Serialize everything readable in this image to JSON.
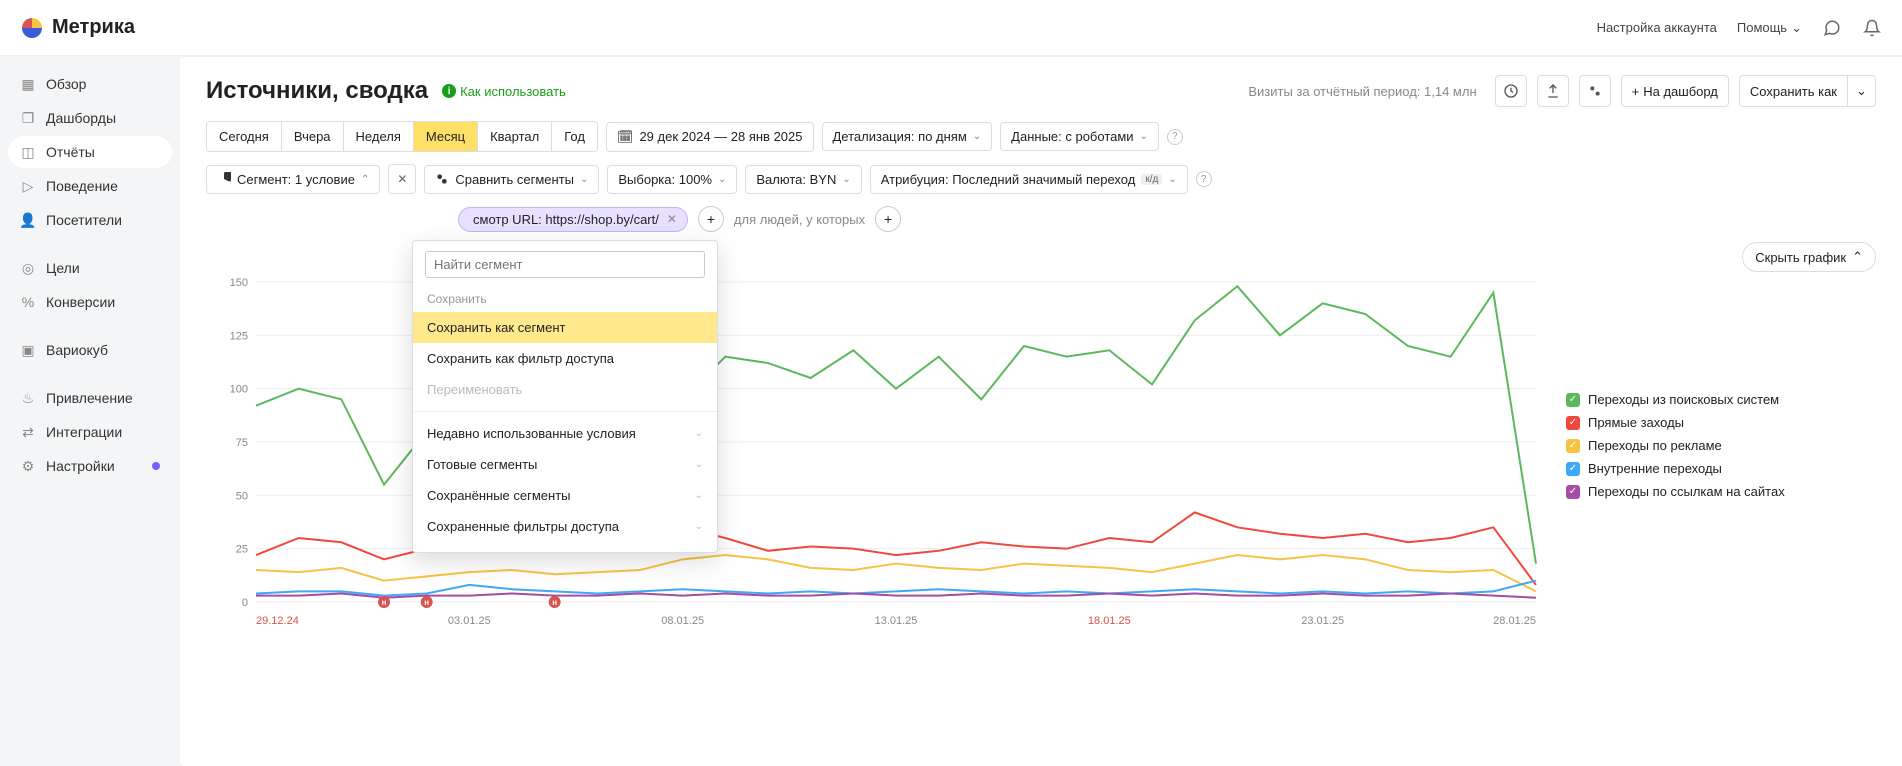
{
  "header": {
    "brand": "Метрика",
    "account": "Настройка аккаунта",
    "help": "Помощь"
  },
  "sidebar": {
    "items": [
      {
        "label": "Обзор"
      },
      {
        "label": "Дашборды"
      },
      {
        "label": "Отчёты"
      },
      {
        "label": "Поведение"
      },
      {
        "label": "Посетители"
      },
      {
        "label": "Цели"
      },
      {
        "label": "Конверсии"
      },
      {
        "label": "Вариокуб"
      },
      {
        "label": "Привлечение"
      },
      {
        "label": "Интеграции"
      },
      {
        "label": "Настройки"
      }
    ]
  },
  "page": {
    "title": "Источники, сводка",
    "help_link": "Как использовать",
    "visits_text": "Визиты за отчётный период: 1,14 млн",
    "to_dashboard": "На дашборд",
    "save_as": "Сохранить как"
  },
  "period": {
    "segments": [
      "Сегодня",
      "Вчера",
      "Неделя",
      "Месяц",
      "Квартал",
      "Год"
    ],
    "active_index": 3,
    "range": "29 дек 2024 — 28 янв 2025",
    "detail": "Детализация: по дням",
    "data": "Данные: с роботами"
  },
  "filters": {
    "segment_label": "Сегмент: 1 условие",
    "compare": "Сравнить сегменты",
    "sample": "Выборка: 100%",
    "currency": "Валюта: BYN",
    "attribution": "Атрибуция: Последний значимый переход",
    "attr_badge": "к/д"
  },
  "chip": {
    "text": "смотр URL: https://shop.by/cart/",
    "suffix": "для людей, у которых"
  },
  "dropdown": {
    "placeholder": "Найти сегмент",
    "save_head": "Сохранить",
    "save_as_segment": "Сохранить как сегмент",
    "save_as_filter": "Сохранить как фильтр доступа",
    "rename": "Переименовать",
    "groups": [
      "Недавно использованные условия",
      "Готовые сегменты",
      "Сохранённые сегменты",
      "Сохраненные фильтры доступа"
    ]
  },
  "chart": {
    "hide": "Скрыть график",
    "legend": [
      {
        "label": "Переходы из поисковых систем",
        "color": "#5cb85c"
      },
      {
        "label": "Прямые заходы",
        "color": "#f0483e"
      },
      {
        "label": "Переходы по рекламе",
        "color": "#f6c343"
      },
      {
        "label": "Внутренние переходы",
        "color": "#3fa9f5"
      },
      {
        "label": "Переходы по ссылкам на сайтах",
        "color": "#a64ca6"
      }
    ]
  },
  "chart_data": {
    "type": "line",
    "xlabel": "",
    "ylabel": "",
    "ylim": [
      0,
      150
    ],
    "y_ticks": [
      0,
      25,
      50,
      75,
      100,
      125,
      150
    ],
    "x_labels": [
      "29.12.24",
      "03.01.25",
      "08.01.25",
      "13.01.25",
      "18.01.25",
      "23.01.25",
      "28.01.25"
    ],
    "x_red_indexes": [
      0,
      4
    ],
    "categories": [
      "29.12",
      "30.12",
      "31.12",
      "01.01",
      "02.01",
      "03.01",
      "04.01",
      "05.01",
      "06.01",
      "07.01",
      "08.01",
      "09.01",
      "10.01",
      "11.01",
      "12.01",
      "13.01",
      "14.01",
      "15.01",
      "16.01",
      "17.01",
      "18.01",
      "19.01",
      "20.01",
      "21.01",
      "22.01",
      "23.01",
      "24.01",
      "25.01",
      "26.01",
      "27.01",
      "28.01"
    ],
    "holiday_markers": [
      3,
      4,
      7
    ],
    "series": [
      {
        "name": "Переходы из поисковых систем",
        "color": "#5cb85c",
        "values": [
          92,
          100,
          95,
          55,
          80,
          78,
          90,
          96,
          100,
          88,
          95,
          115,
          112,
          105,
          118,
          100,
          115,
          95,
          120,
          115,
          118,
          102,
          132,
          148,
          125,
          140,
          135,
          120,
          115,
          145,
          18
        ]
      },
      {
        "name": "Прямые заходы",
        "color": "#f0483e",
        "values": [
          22,
          30,
          28,
          20,
          25,
          26,
          28,
          32,
          30,
          28,
          35,
          30,
          24,
          26,
          25,
          22,
          24,
          28,
          26,
          25,
          30,
          28,
          42,
          35,
          32,
          30,
          32,
          28,
          30,
          35,
          8
        ]
      },
      {
        "name": "Переходы по рекламе",
        "color": "#f6c343",
        "values": [
          15,
          14,
          16,
          10,
          12,
          14,
          15,
          13,
          14,
          15,
          20,
          22,
          20,
          16,
          15,
          18,
          16,
          15,
          18,
          17,
          16,
          14,
          18,
          22,
          20,
          22,
          20,
          15,
          14,
          15,
          5
        ]
      },
      {
        "name": "Внутренние переходы",
        "color": "#3fa9f5",
        "values": [
          4,
          5,
          5,
          3,
          4,
          8,
          6,
          5,
          4,
          5,
          6,
          5,
          4,
          5,
          4,
          5,
          6,
          5,
          4,
          5,
          4,
          5,
          6,
          5,
          4,
          5,
          4,
          5,
          4,
          5,
          10
        ]
      },
      {
        "name": "Переходы по ссылкам на сайтах",
        "color": "#a64ca6",
        "values": [
          3,
          3,
          4,
          2,
          3,
          3,
          4,
          3,
          3,
          4,
          3,
          4,
          3,
          3,
          4,
          3,
          3,
          4,
          3,
          3,
          4,
          3,
          4,
          3,
          3,
          4,
          3,
          3,
          4,
          3,
          2
        ]
      }
    ]
  }
}
